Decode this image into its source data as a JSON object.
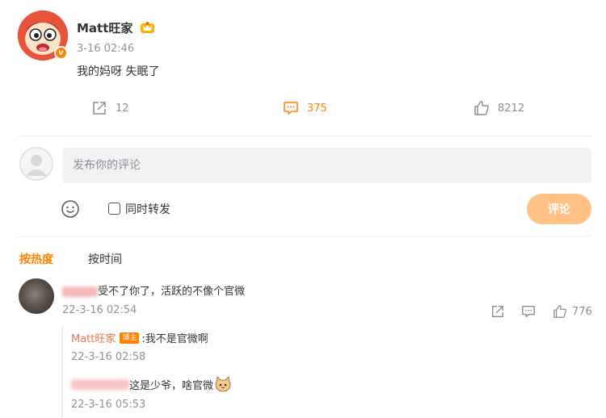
{
  "post": {
    "author": "Matt旺家",
    "time": "3-16 02:46",
    "text": "我的妈呀 失眠了",
    "share_count": "12",
    "comment_count": "375",
    "like_count": "8212"
  },
  "compose": {
    "placeholder": "发布你的评论",
    "repost_label": "同时转发",
    "submit_label": "评论"
  },
  "sort_tabs": {
    "hot": "按热度",
    "time": "按时间"
  },
  "comments": [
    {
      "text": "受不了你了，活跃的不像个官微",
      "time": "22-3-16 02:54",
      "like_count": "776",
      "replies": [
        {
          "author": "Matt旺家",
          "badge": "博主",
          "text": ":我不是官微啊",
          "time": "22-3-16 02:58"
        },
        {
          "text": "这是少爷，啥官微",
          "time": "22-3-16 05:53"
        }
      ]
    }
  ],
  "colors": {
    "accent": "#ff8200",
    "reply_name": "#eb7350",
    "muted": "#939393",
    "submit_disabled": "#ffc184"
  }
}
